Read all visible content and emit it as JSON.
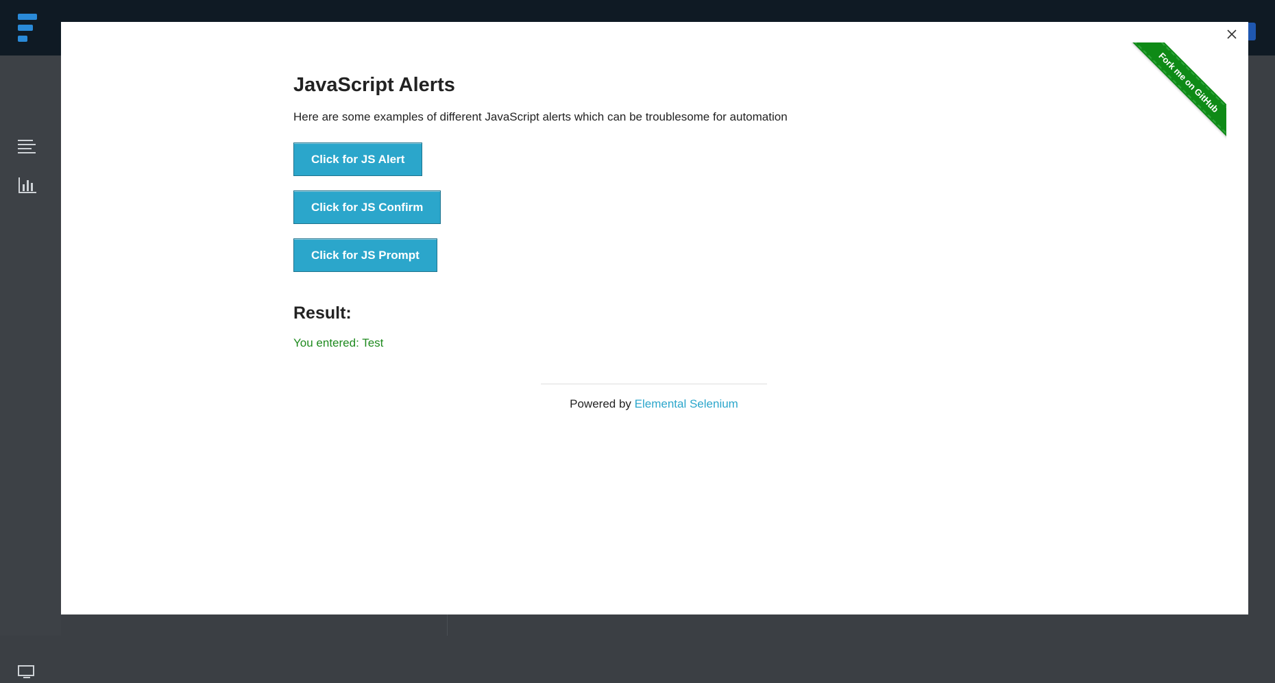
{
  "page": {
    "title": "JavaScript Alerts",
    "description": "Here are some examples of different JavaScript alerts which can be troublesome for automation",
    "buttons": [
      {
        "label": "Click for JS Alert"
      },
      {
        "label": "Click for JS Confirm"
      },
      {
        "label": "Click for JS Prompt"
      }
    ],
    "result_heading": "Result:",
    "result_text": "You entered: Test"
  },
  "ribbon": {
    "label": "Fork me on GitHub",
    "color": "#0e8a16"
  },
  "footer": {
    "prefix": "Powered by ",
    "link_label": "Elemental Selenium",
    "link_color": "#2ba6cb"
  },
  "modal": {
    "close_icon": "close-icon"
  },
  "colors": {
    "button_bg": "#2ba6cb",
    "result_text": "#1e8a1e",
    "background_app": "#3b3f44",
    "topbar": "#0f1a24"
  }
}
